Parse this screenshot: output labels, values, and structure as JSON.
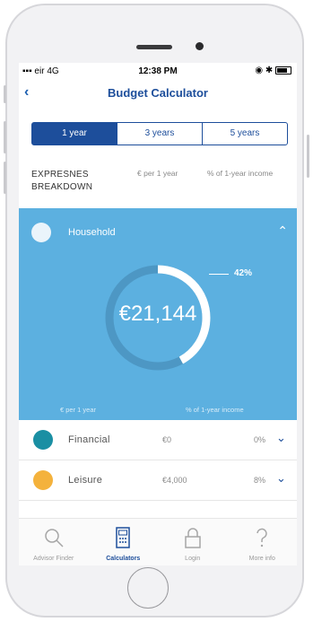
{
  "status": {
    "carrier": "eir 4G",
    "time": "12:38 PM"
  },
  "nav": {
    "back": "‹",
    "title": "Budget Calculator"
  },
  "segments": [
    {
      "label": "1 year",
      "active": true
    },
    {
      "label": "3 years",
      "active": false
    },
    {
      "label": "5 years",
      "active": false
    }
  ],
  "expenses": {
    "title_line1": "EXPRESNES",
    "title_line2": "BREAKDOWN",
    "col_per_year": "€ per 1 year",
    "col_pct": "% of 1-year income"
  },
  "household": {
    "label": "Household",
    "amount": "€21,144",
    "percent": "42%",
    "percent_value": 0.42,
    "foot_left": "€ per 1 year",
    "foot_right": "% of 1-year income"
  },
  "rows": [
    {
      "name": "Financial",
      "value": "€0",
      "pct": "0%",
      "color": "#1a8fa3"
    },
    {
      "name": "Leisure",
      "value": "€4,000",
      "pct": "8%",
      "color": "#f4b23c"
    }
  ],
  "tabs": [
    {
      "label": "Advisor Finder",
      "icon": "search-icon",
      "active": false
    },
    {
      "label": "Calculators",
      "icon": "calculator-icon",
      "active": true
    },
    {
      "label": "Login",
      "icon": "lock-icon",
      "active": false
    },
    {
      "label": "More info",
      "icon": "question-icon",
      "active": false
    }
  ],
  "colors": {
    "accent": "#1d4e9b",
    "household_bg": "#5cb0e0"
  }
}
